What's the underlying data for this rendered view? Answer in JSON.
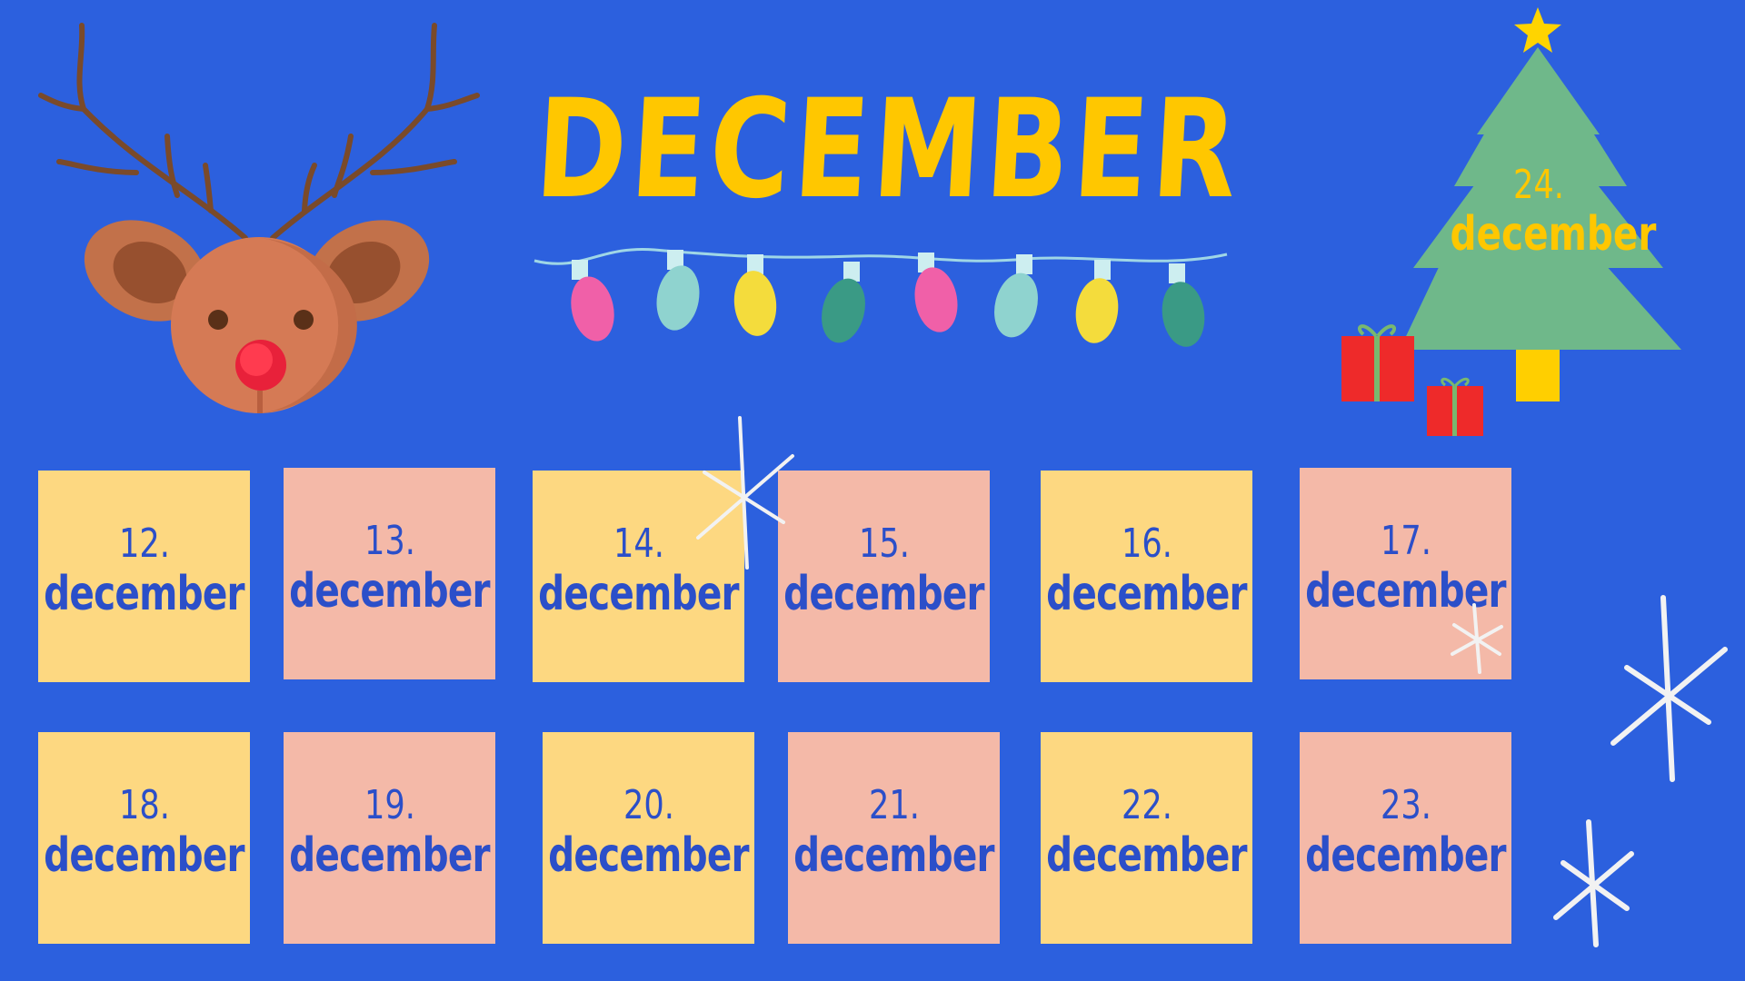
{
  "title": "DECEMBER",
  "colors": {
    "background": "#2c60de",
    "title": "#ffc700",
    "card_yellow": "#fdd881",
    "card_pink": "#f4b9a8",
    "card_text": "#2b4fc9"
  },
  "decorations": {
    "reindeer": "reindeer-head-icon",
    "lights": "string-lights-icon",
    "tree": "christmas-tree-icon",
    "gifts": "gift-box-icon",
    "snowflakes": "snowflake-icon"
  },
  "tree_day": {
    "number": "24.",
    "month": "december"
  },
  "days": [
    {
      "number": "12.",
      "month": "december",
      "color": "yellow"
    },
    {
      "number": "13.",
      "month": "december",
      "color": "pink"
    },
    {
      "number": "14.",
      "month": "december",
      "color": "yellow"
    },
    {
      "number": "15.",
      "month": "december",
      "color": "pink"
    },
    {
      "number": "16.",
      "month": "december",
      "color": "yellow"
    },
    {
      "number": "17.",
      "month": "december",
      "color": "pink"
    },
    {
      "number": "18.",
      "month": "december",
      "color": "yellow"
    },
    {
      "number": "19.",
      "month": "december",
      "color": "pink"
    },
    {
      "number": "20.",
      "month": "december",
      "color": "yellow"
    },
    {
      "number": "21.",
      "month": "december",
      "color": "pink"
    },
    {
      "number": "22.",
      "month": "december",
      "color": "yellow"
    },
    {
      "number": "23.",
      "month": "december",
      "color": "pink"
    }
  ]
}
